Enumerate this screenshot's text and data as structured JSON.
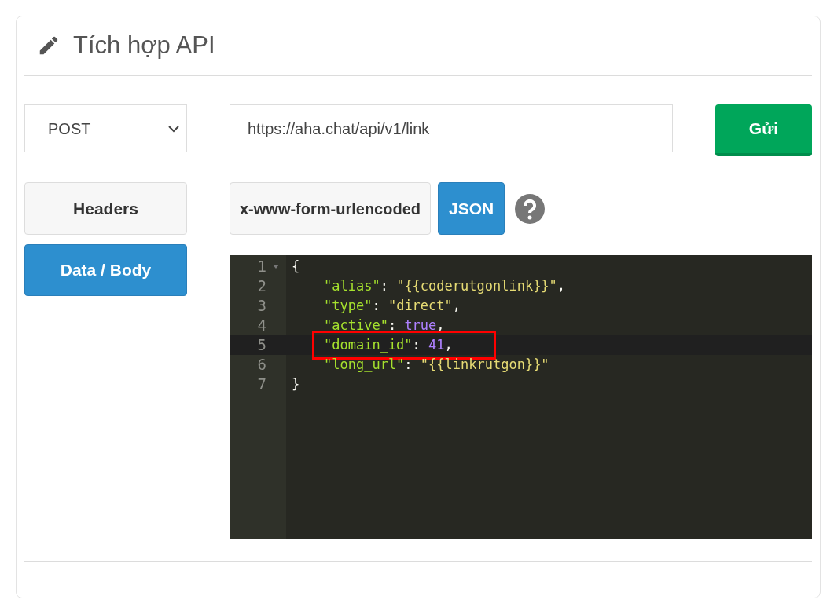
{
  "title": "Tích hợp API",
  "method": {
    "value": "POST"
  },
  "url": {
    "value": "https://aha.chat/api/v1/link"
  },
  "send_button": "Gửi",
  "sections": [
    {
      "label": "Headers",
      "selected": false
    },
    {
      "label": "Data / Body",
      "selected": true
    }
  ],
  "body_types": [
    {
      "label": "x-www-form-urlencoded",
      "selected": false
    },
    {
      "label": "JSON",
      "selected": true
    }
  ],
  "editor": {
    "lines": [
      {
        "number": "1",
        "indented": false,
        "active": false,
        "highlighted": false,
        "tokens": [
          {
            "kind": "punct",
            "text": "{"
          }
        ]
      },
      {
        "number": "2",
        "indented": true,
        "active": false,
        "highlighted": false,
        "tokens": [
          {
            "kind": "key",
            "text": "\"alias\""
          },
          {
            "kind": "punct",
            "text": ": "
          },
          {
            "kind": "string",
            "text": "\"{{coderutgonlink}}\""
          },
          {
            "kind": "punct",
            "text": ","
          }
        ]
      },
      {
        "number": "3",
        "indented": true,
        "active": false,
        "highlighted": false,
        "tokens": [
          {
            "kind": "key",
            "text": "\"type\""
          },
          {
            "kind": "punct",
            "text": ": "
          },
          {
            "kind": "string",
            "text": "\"direct\""
          },
          {
            "kind": "punct",
            "text": ","
          }
        ]
      },
      {
        "number": "4",
        "indented": true,
        "active": false,
        "highlighted": false,
        "tokens": [
          {
            "kind": "key",
            "text": "\"active\""
          },
          {
            "kind": "punct",
            "text": ": "
          },
          {
            "kind": "literal",
            "text": "true"
          },
          {
            "kind": "punct",
            "text": ","
          }
        ]
      },
      {
        "number": "5",
        "indented": true,
        "active": true,
        "highlighted": true,
        "tokens": [
          {
            "kind": "key",
            "text": "\"domain_id\""
          },
          {
            "kind": "punct",
            "text": ": "
          },
          {
            "kind": "literal",
            "text": "41"
          },
          {
            "kind": "punct",
            "text": ","
          }
        ]
      },
      {
        "number": "6",
        "indented": true,
        "active": false,
        "highlighted": false,
        "tokens": [
          {
            "kind": "key",
            "text": "\"long_url\""
          },
          {
            "kind": "punct",
            "text": ": "
          },
          {
            "kind": "string",
            "text": "\"{{linkrutgon}}\""
          }
        ]
      },
      {
        "number": "7",
        "indented": false,
        "active": false,
        "highlighted": false,
        "tokens": [
          {
            "kind": "punct",
            "text": "}"
          }
        ]
      }
    ]
  }
}
